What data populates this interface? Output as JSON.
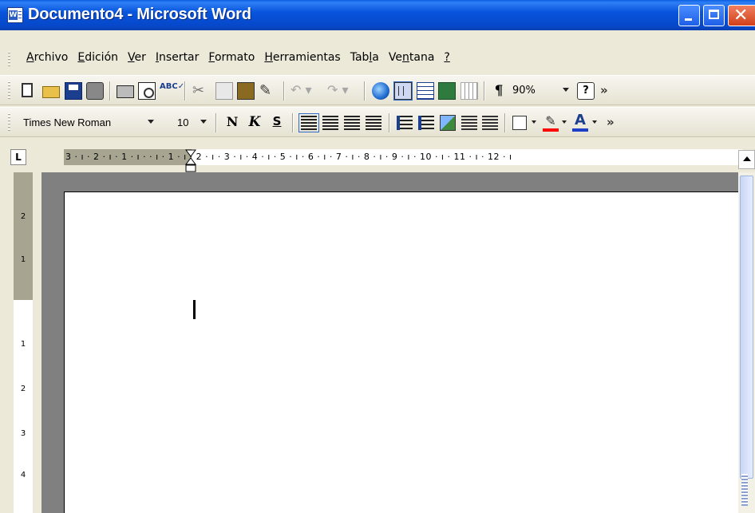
{
  "window": {
    "title": "Documento4 - Microsoft Word",
    "app_icon_glyph": "W",
    "close_glyph": "✕"
  },
  "menu": {
    "items": [
      {
        "prefix": "",
        "key": "A",
        "rest": "rchivo"
      },
      {
        "prefix": "",
        "key": "E",
        "rest": "dición"
      },
      {
        "prefix": "",
        "key": "V",
        "rest": "er"
      },
      {
        "prefix": "",
        "key": "I",
        "rest": "nsertar"
      },
      {
        "prefix": "",
        "key": "F",
        "rest": "ormato"
      },
      {
        "prefix": "",
        "key": "H",
        "rest": "erramientas"
      },
      {
        "prefix": "Tab",
        "key": "l",
        "rest": "a"
      },
      {
        "prefix": "Ve",
        "key": "n",
        "rest": "tana"
      },
      {
        "prefix": "",
        "key": "?",
        "rest": ""
      }
    ]
  },
  "standard_toolbar": {
    "spell_glyph": "ABC✓",
    "cut_glyph": "✂",
    "brush_glyph": "✎",
    "undo_glyph": "↶ ▾",
    "redo_glyph": "↷ ▾",
    "paragraph_glyph": "¶",
    "zoom": "90%",
    "help_glyph": "?",
    "overflow_glyph": "»"
  },
  "formatting_toolbar": {
    "font_name": "Times New Roman",
    "font_size": "10",
    "bold_label": "N",
    "italic_label": "K",
    "strike_label": "S",
    "highlight_glyph": "✎",
    "font_color_glyph": "A",
    "overflow_glyph": "»",
    "highlight_color": "#ff0000",
    "font_color": "#1c3ec8"
  },
  "ruler": {
    "tab_selector": "L",
    "horizontal_numbers": "3 · ı · 2 · ı · 1 · ı ·     · ı · 1 · ı · 2 · ı · 3 · ı · 4 · ı · 5 · ı · 6 · ı · 7 · ı · 8 · ı · 9 · ı · 10 · ı · 11 · ı · 12 · ı",
    "vertical_numbers": [
      "2",
      "1",
      "1",
      "2",
      "3",
      "4"
    ]
  },
  "colors": {
    "titlebar": "#0855dd",
    "page": "#ffffff",
    "workspace": "#808080"
  }
}
